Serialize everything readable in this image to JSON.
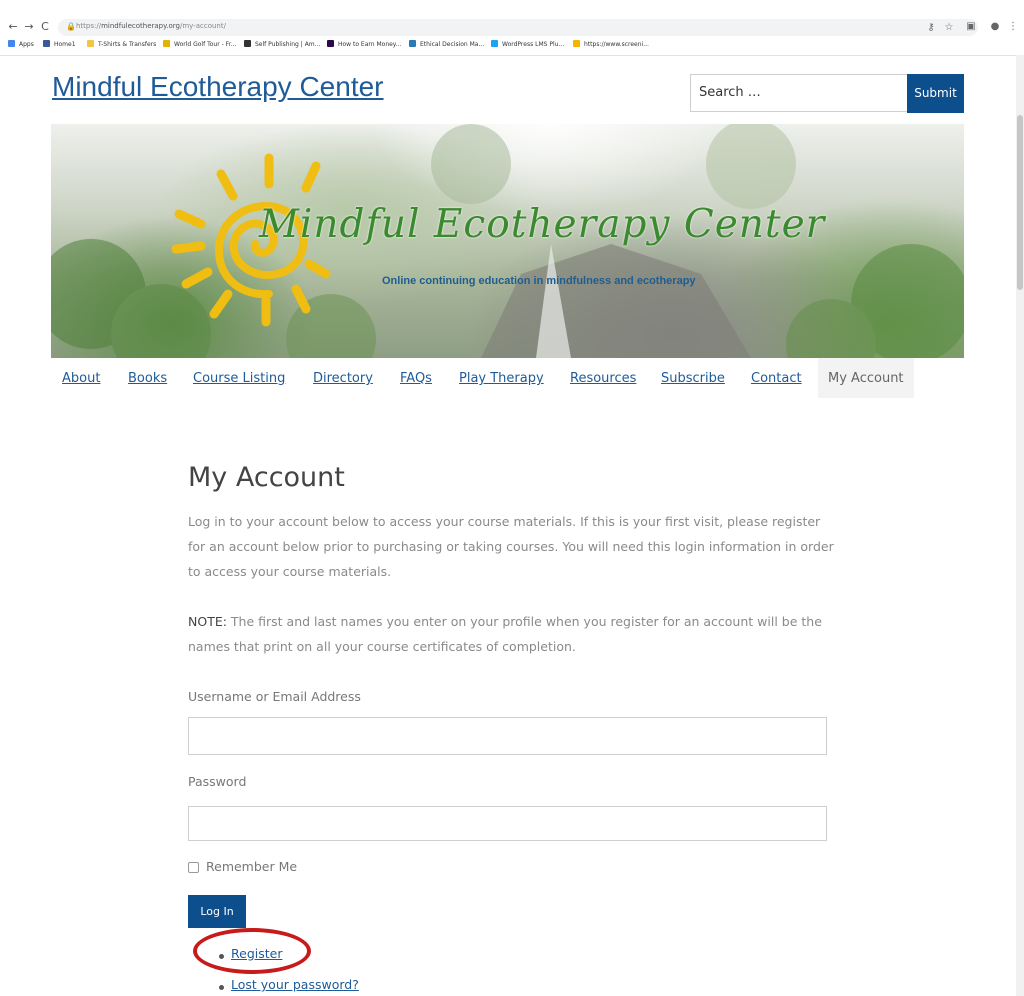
{
  "browser": {
    "url_prefix": "https://",
    "url_domain": "mindfulecotherapy.org",
    "url_path": "/my-account/",
    "nav_back": "←",
    "nav_forward": "→",
    "nav_reload": "C",
    "bookmarks": [
      {
        "label": "Apps",
        "color": "#4285f4"
      },
      {
        "label": "Home1",
        "color": "#3b5998"
      },
      {
        "label": "T-Shirts & Transfers",
        "color": "#f4c542"
      },
      {
        "label": "World Golf Tour - Fr...",
        "color": "#e2b400"
      },
      {
        "label": "Self Publishing | Am...",
        "color": "#333333"
      },
      {
        "label": "How to Earn Money...",
        "color": "#2a0a4a"
      },
      {
        "label": "Ethical Decision Ma...",
        "color": "#2a7ab8"
      },
      {
        "label": "WordPress LMS Plu...",
        "color": "#1da1f2"
      },
      {
        "label": "https://www.screeni...",
        "color": "#f4b400"
      }
    ]
  },
  "header": {
    "site_title": "Mindful Ecotherapy Center",
    "search_placeholder": "Search …",
    "search_button": "Submit"
  },
  "banner": {
    "title": "Mindful Ecotherapy Center",
    "subtitle": "Online continuing education in mindfulness and ecotherapy"
  },
  "nav": {
    "items": [
      "About",
      "Books",
      "Course Listing",
      "Directory",
      "FAQs",
      "Play Therapy",
      "Resources",
      "Subscribe",
      "Contact",
      "My Account"
    ]
  },
  "main": {
    "title": "My Account",
    "intro": "Log in to your account below to access your course materials. If this is your first visit, please register for an account below prior to purchasing or taking courses. You will need this login information in order to access your course materials.",
    "note_label": "NOTE:",
    "note_text": " The first and last names you enter on your profile when you register for an account will be the names that print on all your course certificates of completion.",
    "username_label": "Username or Email Address",
    "password_label": "Password",
    "remember_label": "Remember Me",
    "login_button": "Log In",
    "register_link": "Register",
    "lost_password_link": "Lost your password?"
  },
  "colors": {
    "accent": "#0d4f8c",
    "link": "#1e5b98",
    "annotation": "#c71a1a"
  }
}
